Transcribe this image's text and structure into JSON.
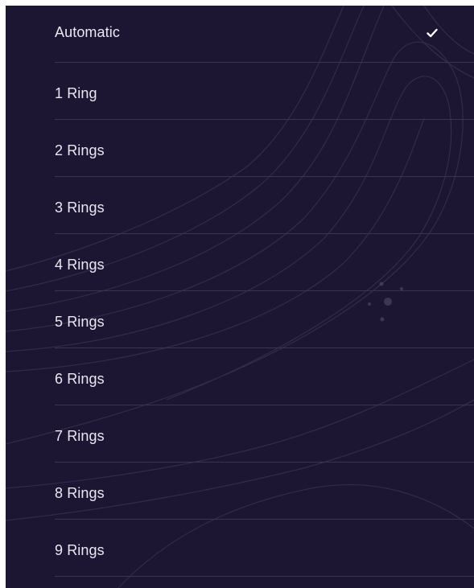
{
  "menu": {
    "items": [
      {
        "label": "Automatic",
        "selected": true
      },
      {
        "label": "1 Ring",
        "selected": false
      },
      {
        "label": "2 Rings",
        "selected": false
      },
      {
        "label": "3 Rings",
        "selected": false
      },
      {
        "label": "4 Rings",
        "selected": false
      },
      {
        "label": "5 Rings",
        "selected": false
      },
      {
        "label": "6 Rings",
        "selected": false
      },
      {
        "label": "7 Rings",
        "selected": false
      },
      {
        "label": "8 Rings",
        "selected": false
      },
      {
        "label": "9 Rings",
        "selected": false
      }
    ],
    "selected_icon": "checkmark-icon"
  },
  "colors": {
    "background": "#1d1632",
    "text": "#e9e7f0",
    "divider": "#3a3450",
    "checkmark": "#ffffff"
  }
}
